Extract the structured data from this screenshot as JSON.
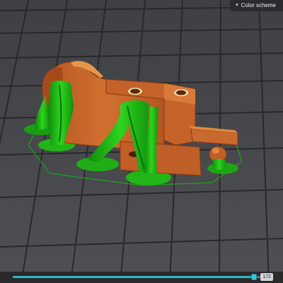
{
  "toolbar": {
    "color_scheme_label": "Color scheme",
    "color_scheme_icon": "chevron-down-icon"
  },
  "preview": {
    "model_color": "#c8682f",
    "support_color": "#25c21a",
    "bed_color": "#4a4b4e",
    "grid_color": "#2a2b2d"
  },
  "layer_slider": {
    "value_label": "172",
    "position": 0.975,
    "accent_color": "#2fb9c9"
  }
}
